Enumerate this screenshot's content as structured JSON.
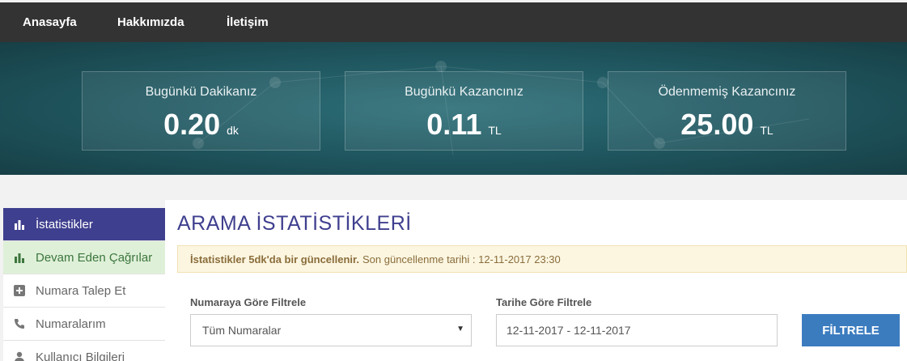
{
  "nav": {
    "items": [
      {
        "label": "Anasayfa"
      },
      {
        "label": "Hakkımızda"
      },
      {
        "label": "İletişim"
      }
    ]
  },
  "stats": [
    {
      "label": "Bugünkü Dakikanız",
      "value": "0.20",
      "unit": "dk"
    },
    {
      "label": "Bugünkü Kazancınız",
      "value": "0.11",
      "unit": "TL"
    },
    {
      "label": "Ödenmemiş Kazancınız",
      "value": "25.00",
      "unit": "TL"
    }
  ],
  "sidebar": {
    "items": [
      {
        "label": "İstatistikler",
        "icon": "bar-chart-icon"
      },
      {
        "label": "Devam Eden Çağrılar",
        "icon": "bar-chart-icon"
      },
      {
        "label": "Numara Talep Et",
        "icon": "plus-square-icon"
      },
      {
        "label": "Numaralarım",
        "icon": "phone-icon"
      },
      {
        "label": "Kullanıcı Bilgileri",
        "icon": "user-icon"
      }
    ]
  },
  "main": {
    "title": "ARAMA İSTATİSTİKLERİ",
    "alert_bold": "İstatistikler 5dk'da bir güncellenir.",
    "alert_text": "Son güncellenme tarihi : 12-11-2017 23:30",
    "filter_number_label": "Numaraya Göre Filtrele",
    "filter_number_value": "Tüm Numaralar",
    "filter_date_label": "Tarihe Göre Filtrele",
    "filter_date_value": "12-11-2017 - 12-11-2017",
    "filter_button": "FİLTRELE"
  },
  "colors": {
    "nav_bg": "#333333",
    "hero_bg": "#1f555e",
    "sidebar_active": "#3f3f8f",
    "sidebar_highlight": "#dff0d8",
    "title": "#3f3f8f",
    "alert_bg": "#fcf6e1",
    "button": "#3b7cbf"
  }
}
